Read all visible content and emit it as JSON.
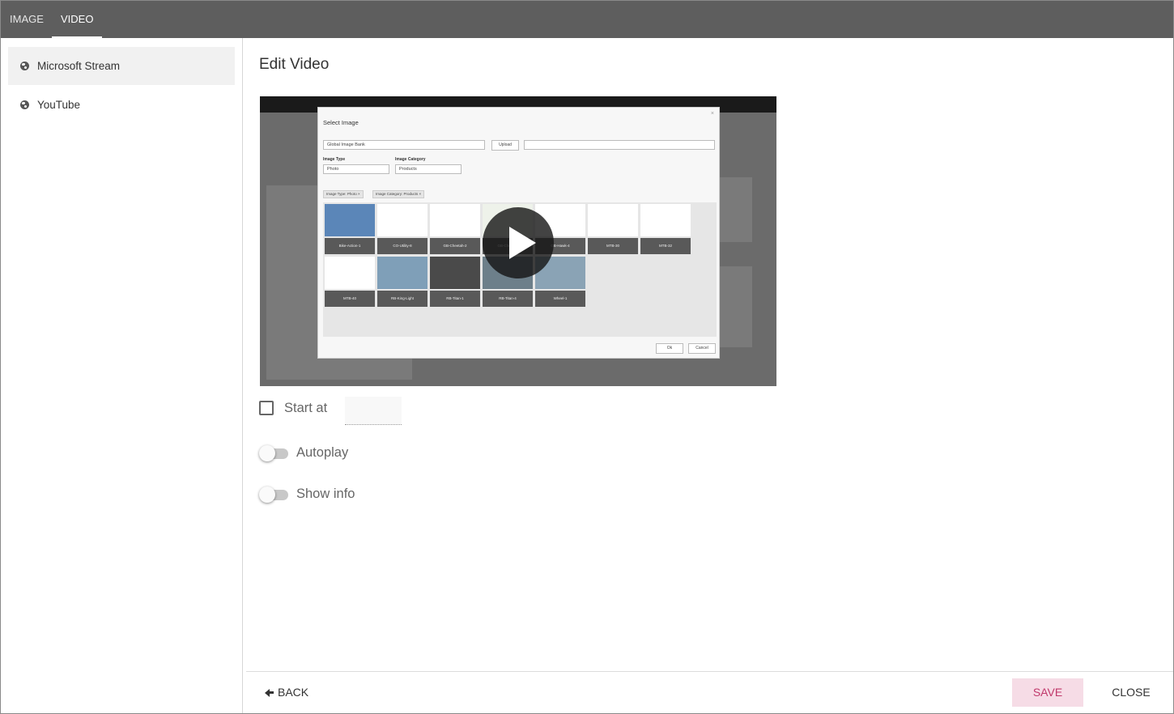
{
  "tabs": [
    {
      "label": "IMAGE",
      "active": false
    },
    {
      "label": "VIDEO",
      "active": true
    }
  ],
  "sidebar": {
    "items": [
      {
        "label": "Microsoft Stream",
        "icon": "globe-icon",
        "active": true
      },
      {
        "label": "YouTube",
        "icon": "globe-icon",
        "active": false
      }
    ]
  },
  "main": {
    "title": "Edit Video",
    "video_preview": {
      "dialog_title": "Select Image",
      "source_select": "Global Image Bank",
      "upload_label": "Upload",
      "image_type_label": "Image Type",
      "image_type_value": "Photo",
      "image_category_label": "Image Category",
      "image_category_value": "Products",
      "chips": [
        "Image Type: Photo ×",
        "Image Category: Products ×"
      ],
      "thumbnails": [
        "Bike-Action-1",
        "CO-Utility-8",
        "GB-Cheetah-2",
        "GB-Cheetah",
        "GB-Hawk-4",
        "MTB-30",
        "MTB-32",
        "MTB-40",
        "RB-King-Light",
        "RB-Titan-1",
        "RB-Titan-4",
        "Wheel-1"
      ],
      "ok_label": "Ok",
      "cancel_label": "Cancel"
    },
    "start_at_label": "Start at",
    "start_at_checked": false,
    "start_at_value": "",
    "autoplay_label": "Autoplay",
    "autoplay_on": false,
    "show_info_label": "Show info",
    "show_info_on": false
  },
  "footer": {
    "back_label": "BACK",
    "save_label": "SAVE",
    "close_label": "CLOSE"
  },
  "colors": {
    "topbar": "#5e5e5e",
    "save_bg": "#f6dce6",
    "save_text": "#c0396b"
  }
}
